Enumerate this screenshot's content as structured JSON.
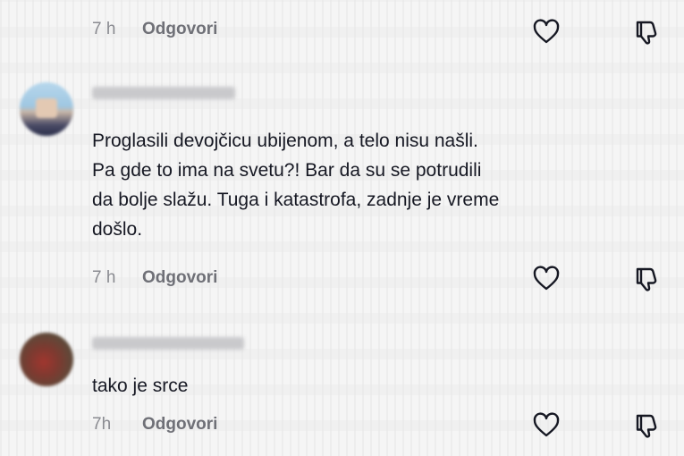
{
  "comments": [
    {
      "time": "7 h",
      "reply_label": "Odgovori",
      "icons": {
        "like": "heart-outline-icon",
        "dislike": "thumbs-down-outline-icon"
      }
    },
    {
      "text_lines": [
        "Proglasili devojčicu ubijenom, a telo nisu našli.",
        "Pa gde to ima na svetu?! Bar da su se potrudili",
        "da bolje slažu. Tuga i katastrofa, zadnje je vreme",
        "došlo."
      ],
      "time": "7 h",
      "reply_label": "Odgovori",
      "icons": {
        "like": "heart-outline-icon",
        "dislike": "thumbs-down-outline-icon"
      }
    },
    {
      "text_lines": [
        "tako je srce"
      ],
      "time": "7h",
      "reply_label": "Odgovori",
      "icons": {
        "like": "heart-outline-icon",
        "dislike": "thumbs-down-outline-icon"
      }
    }
  ],
  "colors": {
    "background": "#f5f5f5",
    "text": "#161823",
    "meta": "#8a8b91",
    "icon": "#161823"
  }
}
